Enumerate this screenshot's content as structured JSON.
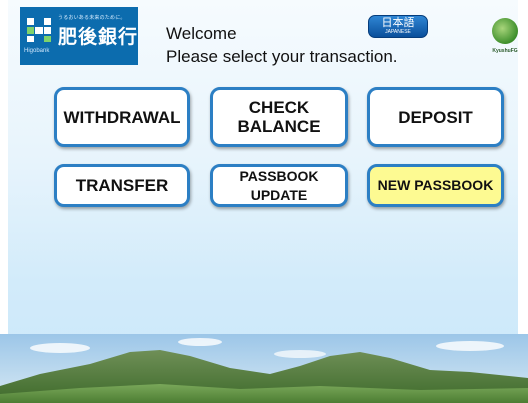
{
  "bank": {
    "name": "肥後銀行",
    "tagline": "うるおいある未来のために。",
    "name_en": "Higobank"
  },
  "header": {
    "welcome": "Welcome",
    "instruction": "Please select your transaction."
  },
  "language_button": {
    "label": "日本語",
    "sublabel": "JAPANESE"
  },
  "group_logo": {
    "label": "KyushuFG"
  },
  "transactions": {
    "withdrawal": "WITHDRAWAL",
    "check_balance_line1": "CHECK",
    "check_balance_line2": "BALANCE",
    "deposit": "DEPOSIT",
    "transfer": "TRANSFER",
    "passbook_update": "PASSBOOK UPDATE",
    "new_passbook": "NEW PASSBOOK"
  },
  "colors": {
    "brand_blue": "#0c6cae",
    "button_border": "#2c7fc4",
    "highlight_yellow": "#fdfa92"
  }
}
